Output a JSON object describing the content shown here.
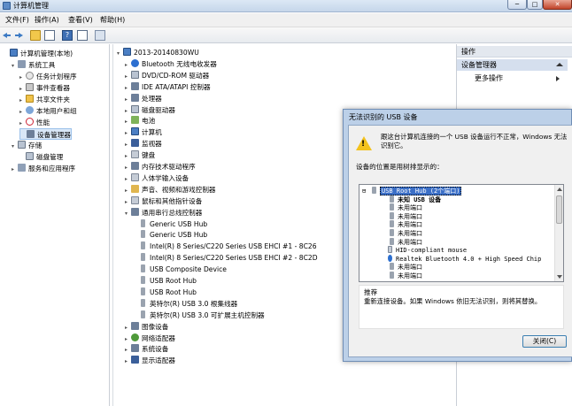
{
  "window": {
    "title": "计算机管理",
    "min": "─",
    "max": "□",
    "close": "✕"
  },
  "menu": [
    "文件(F)",
    "操作(A)",
    "查看(V)",
    "帮助(H)"
  ],
  "toolbar": {
    "help": "?"
  },
  "left_tree": [
    {
      "label": "计算机管理(本地)",
      "icon": "computer-management-icon",
      "exp": ""
    },
    {
      "label": "系统工具",
      "icon": "system-tools-icon",
      "exp": "▾"
    },
    {
      "label": "任务计划程序",
      "icon": "task-scheduler-icon",
      "exp": "▸"
    },
    {
      "label": "事件查看器",
      "icon": "event-viewer-icon",
      "exp": "▸"
    },
    {
      "label": "共享文件夹",
      "icon": "shared-folders-icon",
      "exp": "▸"
    },
    {
      "label": "本地用户和组",
      "icon": "users-icon",
      "exp": "▸"
    },
    {
      "label": "性能",
      "icon": "performance-icon",
      "exp": "▸"
    },
    {
      "label": "设备管理器",
      "icon": "device-manager-icon",
      "exp": ""
    },
    {
      "label": "存储",
      "icon": "storage-icon",
      "exp": "▾"
    },
    {
      "label": "磁盘管理",
      "icon": "disk-icon",
      "exp": ""
    },
    {
      "label": "服务和应用程序",
      "icon": "services-icon",
      "exp": "▸"
    }
  ],
  "device_tree": [
    {
      "label": "2013-20140830WU",
      "icon": "computer-icon",
      "exp": "▾"
    },
    {
      "label": "Bluetooth 无线电收发器",
      "icon": "bluetooth-icon",
      "exp": "▸"
    },
    {
      "label": "DVD/CD-ROM 驱动器",
      "icon": "dvd-icon",
      "exp": "▸"
    },
    {
      "label": "IDE ATA/ATAPI 控制器",
      "icon": "ide-icon",
      "exp": "▸"
    },
    {
      "label": "处理器",
      "icon": "cpu-icon",
      "exp": "▸"
    },
    {
      "label": "磁盘驱动器",
      "icon": "disk-drive-icon",
      "exp": "▸"
    },
    {
      "label": "电池",
      "icon": "battery-icon",
      "exp": "▸"
    },
    {
      "label": "计算机",
      "icon": "computer-icon",
      "exp": "▸"
    },
    {
      "label": "监视器",
      "icon": "monitor-icon",
      "exp": "▸"
    },
    {
      "label": "键盘",
      "icon": "keyboard-icon",
      "exp": "▸"
    },
    {
      "label": "内存技术驱动程序",
      "icon": "memory-icon",
      "exp": "▸"
    },
    {
      "label": "人体学输入设备",
      "icon": "hid-icon",
      "exp": "▸"
    },
    {
      "label": "声音、视频和游戏控制器",
      "icon": "sound-icon",
      "exp": "▸"
    },
    {
      "label": "鼠标和其他指针设备",
      "icon": "mouse-icon",
      "exp": "▸"
    },
    {
      "label": "通用串行总线控制器",
      "icon": "usb-icon",
      "exp": "▾"
    },
    {
      "label": "Generic USB Hub",
      "icon": "usb-device-icon",
      "exp": ""
    },
    {
      "label": "Generic USB Hub",
      "icon": "usb-device-icon",
      "exp": ""
    },
    {
      "label": "Intel(R) 8 Series/C220 Series USB EHCI #1 - 8C26",
      "icon": "usb-device-icon",
      "exp": ""
    },
    {
      "label": "Intel(R) 8 Series/C220 Series USB EHCI #2 - 8C2D",
      "icon": "usb-device-icon",
      "exp": ""
    },
    {
      "label": "USB Composite Device",
      "icon": "usb-device-icon",
      "exp": ""
    },
    {
      "label": "USB Root Hub",
      "icon": "usb-device-icon",
      "exp": ""
    },
    {
      "label": "USB Root Hub",
      "icon": "usb-device-icon",
      "exp": ""
    },
    {
      "label": "英特尔(R) USB 3.0 根集线器",
      "icon": "usb-device-icon",
      "exp": ""
    },
    {
      "label": "英特尔(R) USB 3.0 可扩展主机控制器",
      "icon": "usb-device-icon",
      "exp": ""
    },
    {
      "label": "图像设备",
      "icon": "camera-icon",
      "exp": "▸"
    },
    {
      "label": "网络适配器",
      "icon": "network-icon",
      "exp": "▸"
    },
    {
      "label": "系统设备",
      "icon": "system-device-icon",
      "exp": "▸"
    },
    {
      "label": "显示适配器",
      "icon": "display-icon",
      "exp": "▸"
    }
  ],
  "actions": {
    "header": "操作",
    "selected": "设备管理器",
    "more": "更多操作"
  },
  "dialog": {
    "title": "无法识别的 USB 设备",
    "message": "跟这台计算机连接的一个 USB 设备运行不正常，Windows 无法识别它。",
    "location_label": "设备的位置是用树排显示的：",
    "tree": [
      {
        "label": "USB Root Hub (2个端口)",
        "indent": 0,
        "cls": "hub-sel",
        "exp": "⊟",
        "icon": "usb-hub-icon"
      },
      {
        "label": "未知 USB 设备",
        "indent": 1,
        "cls": "unk",
        "exp": "",
        "icon": "usb-unknown-icon"
      },
      {
        "label": "未用端口",
        "indent": 1,
        "cls": "",
        "exp": "",
        "icon": "port-icon"
      },
      {
        "label": "未用端口",
        "indent": 1,
        "cls": "",
        "exp": "",
        "icon": "port-icon"
      },
      {
        "label": "未用端口",
        "indent": 1,
        "cls": "",
        "exp": "",
        "icon": "port-icon"
      },
      {
        "label": "未用端口",
        "indent": 1,
        "cls": "",
        "exp": "",
        "icon": "port-icon"
      },
      {
        "label": "未用端口",
        "indent": 1,
        "cls": "",
        "exp": "",
        "icon": "port-icon"
      },
      {
        "label": "HID-compliant mouse",
        "indent": 1,
        "cls": "",
        "exp": "",
        "icon": "mouse-icon"
      },
      {
        "label": "Realtek Bluetooth 4.0 + High Speed Chip",
        "indent": 1,
        "cls": "",
        "exp": "",
        "icon": "bluetooth-icon"
      },
      {
        "label": "未用端口",
        "indent": 1,
        "cls": "",
        "exp": "",
        "icon": "port-icon"
      },
      {
        "label": "未用端口",
        "indent": 1,
        "cls": "",
        "exp": "",
        "icon": "port-icon"
      }
    ],
    "recommend_title": "推荐",
    "recommend_text": "重新连接设备。如果 Windows 依旧无法识别，则将其替换。",
    "close_label": "关闭(C)"
  }
}
